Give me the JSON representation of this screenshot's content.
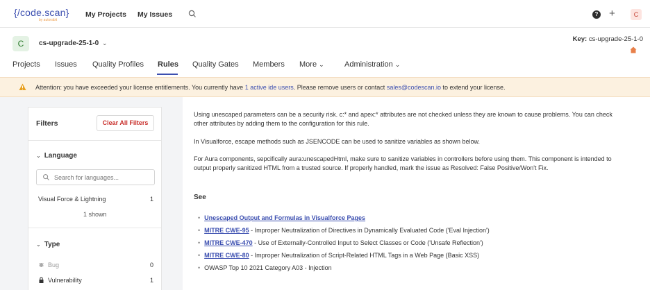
{
  "topnav": {
    "logo": "{/code.scan}",
    "logo_sub": "by autorabit",
    "my_projects": "My Projects",
    "my_issues": "My Issues",
    "avatar": "C"
  },
  "project": {
    "badge": "C",
    "name": "cs-upgrade-25-1-0",
    "key_label": "Key:",
    "key_value": "cs-upgrade-25-1-0",
    "tabs": [
      "Projects",
      "Issues",
      "Quality Profiles",
      "Rules",
      "Quality Gates",
      "Members",
      "More",
      "Administration"
    ],
    "active_tab": "Rules"
  },
  "banner": {
    "text_before": "Attention: you have exceeded your license entitlements. You currently have ",
    "link1": "1 active ide users",
    "text_middle": ". Please remove users or contact ",
    "link2": "sales@codescan.io",
    "text_after": " to extend your license."
  },
  "filters": {
    "title": "Filters",
    "clear_all": "Clear All Filters",
    "language": {
      "title": "Language",
      "search_placeholder": "Search for languages...",
      "items": [
        {
          "label": "Visual Force & Lightning",
          "count": "1"
        }
      ],
      "shown": "1 shown"
    },
    "type": {
      "title": "Type",
      "items": [
        {
          "label": "Bug",
          "count": "0",
          "icon": "bug-icon"
        },
        {
          "label": "Vulnerability",
          "count": "1",
          "icon": "lock-icon"
        }
      ]
    }
  },
  "rule": {
    "paragraphs": [
      "Using unescaped parameters can be a security risk. c:* and apex:* attributes are not checked unless they are known to cause problems. You can check other attributes by adding them to the configuration for this rule.",
      "In Visualforce, escape methods such as JSENCODE can be used to sanitize variables as shown below.",
      "For Aura components, sepcifically aura:unescapedHtml, make sure to sanitize variables in controllers before using them. This component is intended to output properly sanitized HTML from a trusted source. If properly handled, mark the issue as Resolved: False Positive/Won't Fix."
    ],
    "see_title": "See",
    "references": [
      {
        "link": "Unescaped Output and Formulas in Visualforce Pages",
        "text": ""
      },
      {
        "link": "MITRE CWE-95",
        "text": " - Improper Neutralization of Directives in Dynamically Evaluated Code ('Eval Injection')"
      },
      {
        "link": "MITRE CWE-470",
        "text": " - Use of Externally-Controlled Input to Select Classes or Code ('Unsafe Reflection')"
      },
      {
        "link": "MITRE CWE-80",
        "text": " - Improper Neutralization of Script-Related HTML Tags in a Web Page (Basic XSS)"
      },
      {
        "link": "",
        "text": "OWASP Top 10 2021 Category A03 - Injection"
      }
    ]
  },
  "colors": {
    "accent": "#3c4fb0",
    "banner_bg": "#fcf1e0",
    "warning": "#e8a020",
    "danger": "#c9302c"
  }
}
